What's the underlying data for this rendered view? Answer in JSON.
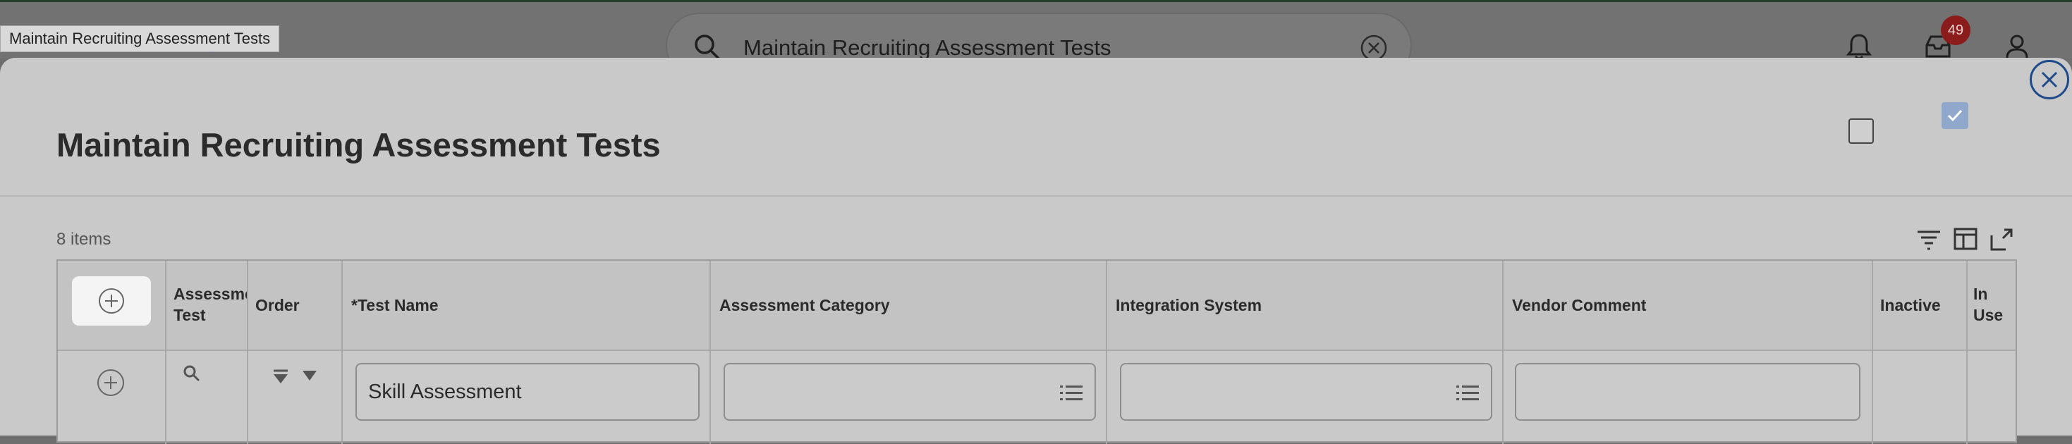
{
  "tooltip": "Maintain Recruiting Assessment Tests",
  "header": {
    "search_value": "Maintain Recruiting Assessment Tests",
    "inbox_count": "49",
    "icons": [
      "search-icon",
      "clear-icon",
      "bell-icon",
      "inbox-icon",
      "user-icon"
    ]
  },
  "modal": {
    "title": "Maintain Recruiting Assessment Tests",
    "item_count": "8 items"
  },
  "grid": {
    "columns": {
      "assessment_test_line1": "Assessme",
      "assessment_test_line2": "Test",
      "order": "Order",
      "test_name": "*Test Name",
      "assessment_category": "Assessment Category",
      "integration_system": "Integration System",
      "vendor_comment": "Vendor Comment",
      "inactive": "Inactive",
      "in_use_line1": "In",
      "in_use_line2": "Use"
    },
    "rows": [
      {
        "test_name": "Skill Assessment",
        "assessment_category": "",
        "integration_system": "",
        "vendor_comment": "",
        "inactive": false,
        "in_use": true
      }
    ]
  },
  "colors": {
    "accent": "#1e4a8a",
    "badge": "#8a1c1c",
    "checked": "#8fa8cb"
  }
}
